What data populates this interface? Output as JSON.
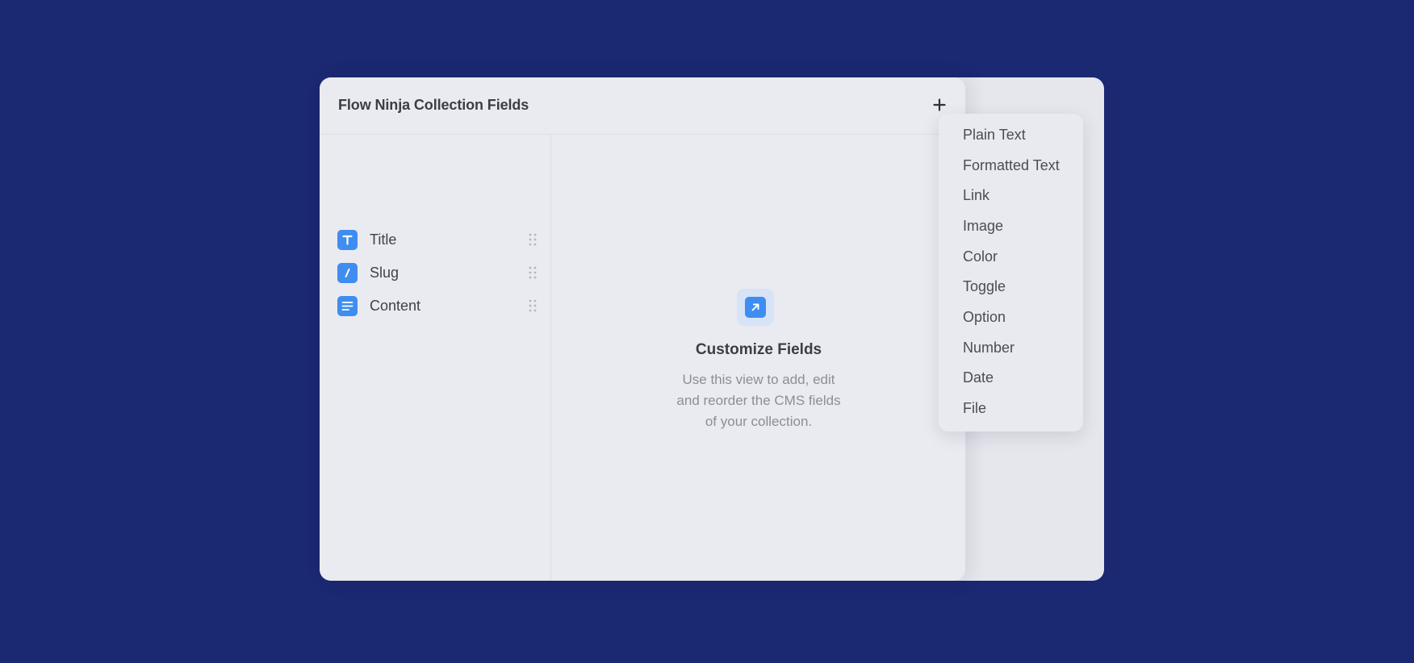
{
  "window": {
    "title": "Flow Ninja Collection Fields",
    "add_button_icon": "plus-icon"
  },
  "sidebar": {
    "fields": [
      {
        "label": "Title",
        "icon": "text-t-icon"
      },
      {
        "label": "Slug",
        "icon": "slug-slash-icon"
      },
      {
        "label": "Content",
        "icon": "paragraph-lines-icon"
      }
    ]
  },
  "empty_state": {
    "icon": "arrow-up-right-icon",
    "title": "Customize Fields",
    "desc_line1": "Use this view to add, edit",
    "desc_line2": "and reorder the CMS fields",
    "desc_line3": "of your collection."
  },
  "dropdown": {
    "items": [
      "Plain Text",
      "Formatted Text",
      "Link",
      "Image",
      "Color",
      "Toggle",
      "Option",
      "Number",
      "Date",
      "File"
    ]
  },
  "colors": {
    "background": "#1b2872",
    "accent": "#3f8df0",
    "panel": "#eaebf0"
  }
}
